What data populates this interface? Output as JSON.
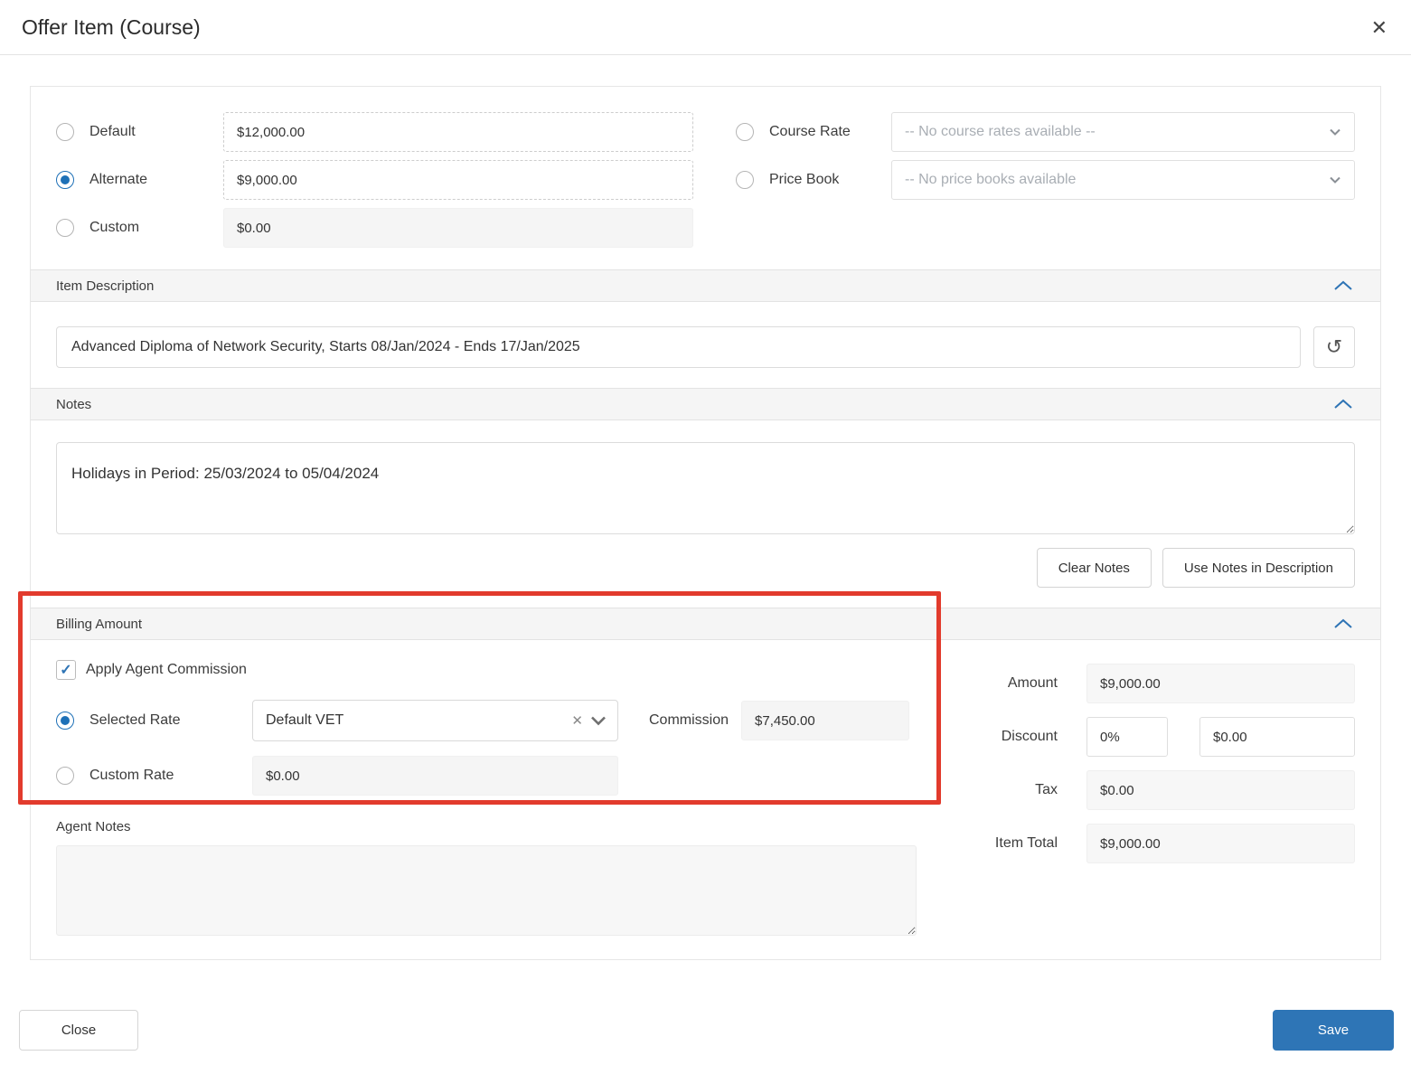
{
  "window": {
    "title": "Offer Item (Course)"
  },
  "icons": {
    "close": "✕",
    "history": "↺",
    "checkmark": "✓",
    "clear": "✕"
  },
  "rates": {
    "options": [
      {
        "label": "Default",
        "value": "$12,000.00",
        "selected": false
      },
      {
        "label": "Alternate",
        "value": "$9,000.00",
        "selected": true
      },
      {
        "label": "Custom",
        "value": "$0.00",
        "selected": false
      }
    ],
    "course_rate": {
      "label": "Course Rate",
      "placeholder": "-- No course rates available --"
    },
    "price_book": {
      "label": "Price Book",
      "placeholder": "-- No price books available"
    }
  },
  "item_description": {
    "header": "Item Description",
    "value": "Advanced Diploma of Network Security, Starts 08/Jan/2024 - Ends 17/Jan/2025"
  },
  "notes": {
    "header": "Notes",
    "value": "Holidays in Period: 25/03/2024 to 05/04/2024",
    "clear_button": "Clear Notes",
    "use_button": "Use Notes in Description"
  },
  "billing": {
    "header": "Billing Amount",
    "apply_commission_label": "Apply Agent Commission",
    "apply_commission_checked": true,
    "selected_rate_label": "Selected Rate",
    "selected_rate_value": "Default VET",
    "commission_label": "Commission",
    "commission_value": "$7,450.00",
    "custom_rate_label": "Custom Rate",
    "custom_rate_value": "$0.00"
  },
  "totals": {
    "amount_label": "Amount",
    "amount_value": "$9,000.00",
    "discount_label": "Discount",
    "discount_percent": "0%",
    "discount_amount": "$0.00",
    "tax_label": "Tax",
    "tax_value": "$0.00",
    "item_total_label": "Item Total",
    "item_total_value": "$9,000.00"
  },
  "agent_notes": {
    "label": "Agent Notes",
    "value": ""
  },
  "footer": {
    "close_button": "Close",
    "save_button": "Save"
  },
  "colors": {
    "accent": "#2e75b6",
    "annotation": "#e23b2d",
    "section_header_bg": "#f5f5f5"
  }
}
